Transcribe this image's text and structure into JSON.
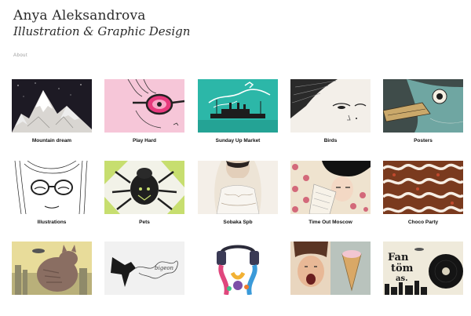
{
  "header": {
    "title": "Anya Aleksandrova",
    "subtitle": "Illustration & Graphic Design",
    "about": "About"
  },
  "portfolio": {
    "items": [
      {
        "label": "Mountain dream",
        "icon": "mountain-illustration"
      },
      {
        "label": "Play Hard",
        "icon": "glasses-girl-illustration"
      },
      {
        "label": "Sunday Up Market",
        "icon": "ship-poster-illustration"
      },
      {
        "label": "Birds",
        "icon": "face-illustration"
      },
      {
        "label": "Posters",
        "icon": "bird-head-illustration"
      },
      {
        "label": "Illustrations",
        "icon": "glasses-face-illustration"
      },
      {
        "label": "Pets",
        "icon": "beetle-illustration"
      },
      {
        "label": "Sobaka Spb",
        "icon": "bride-illustration"
      },
      {
        "label": "Time Out Moscow",
        "icon": "woman-dots-illustration"
      },
      {
        "label": "Choco Party",
        "icon": "chocolate-pattern-illustration"
      },
      {
        "label": "",
        "icon": "giant-cat-illustration"
      },
      {
        "label": "",
        "icon": "pigeon-illustration"
      },
      {
        "label": "",
        "icon": "headphones-illustration"
      },
      {
        "label": "",
        "icon": "faces-collage-illustration"
      },
      {
        "label": "",
        "icon": "fantomas-vinyl-illustration"
      }
    ]
  },
  "colors": {
    "background": "#ffffff",
    "text": "#222222",
    "teal": "#2cb7a8",
    "pink": "#f6c6d8",
    "lime": "#c7de6f"
  }
}
